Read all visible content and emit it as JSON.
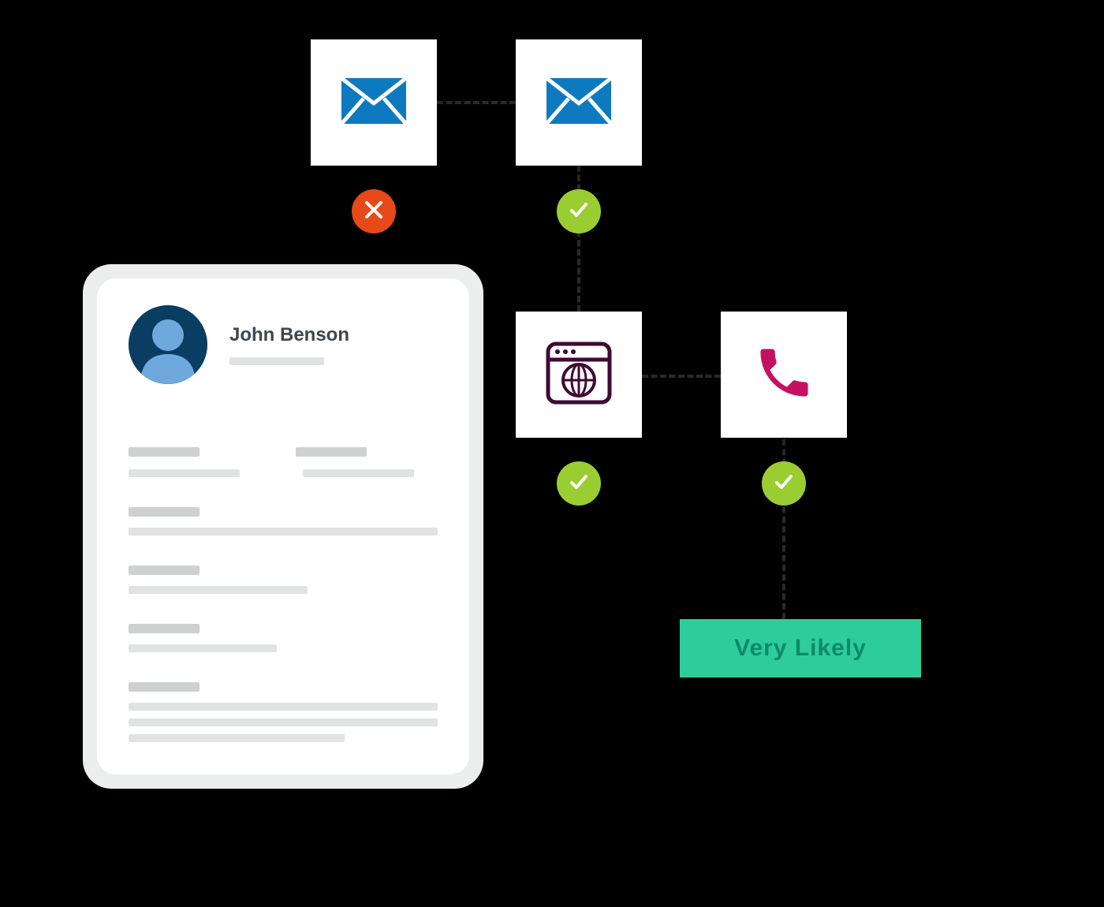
{
  "profile": {
    "name": "John Benson"
  },
  "result": {
    "label": "Very Likely"
  },
  "nodes": {
    "email1": {
      "icon": "mail",
      "status": "fail"
    },
    "email2": {
      "icon": "mail",
      "status": "ok"
    },
    "web": {
      "icon": "browser-globe",
      "status": "ok"
    },
    "phone": {
      "icon": "phone",
      "status": "ok"
    }
  },
  "colors": {
    "mail": "#0d7abf",
    "fail": "#e64a19",
    "ok": "#9acd32",
    "phone": "#c51162",
    "browser": "#3f0a33",
    "result_bg": "#2ecc9b",
    "result_text": "#0d8a68"
  }
}
